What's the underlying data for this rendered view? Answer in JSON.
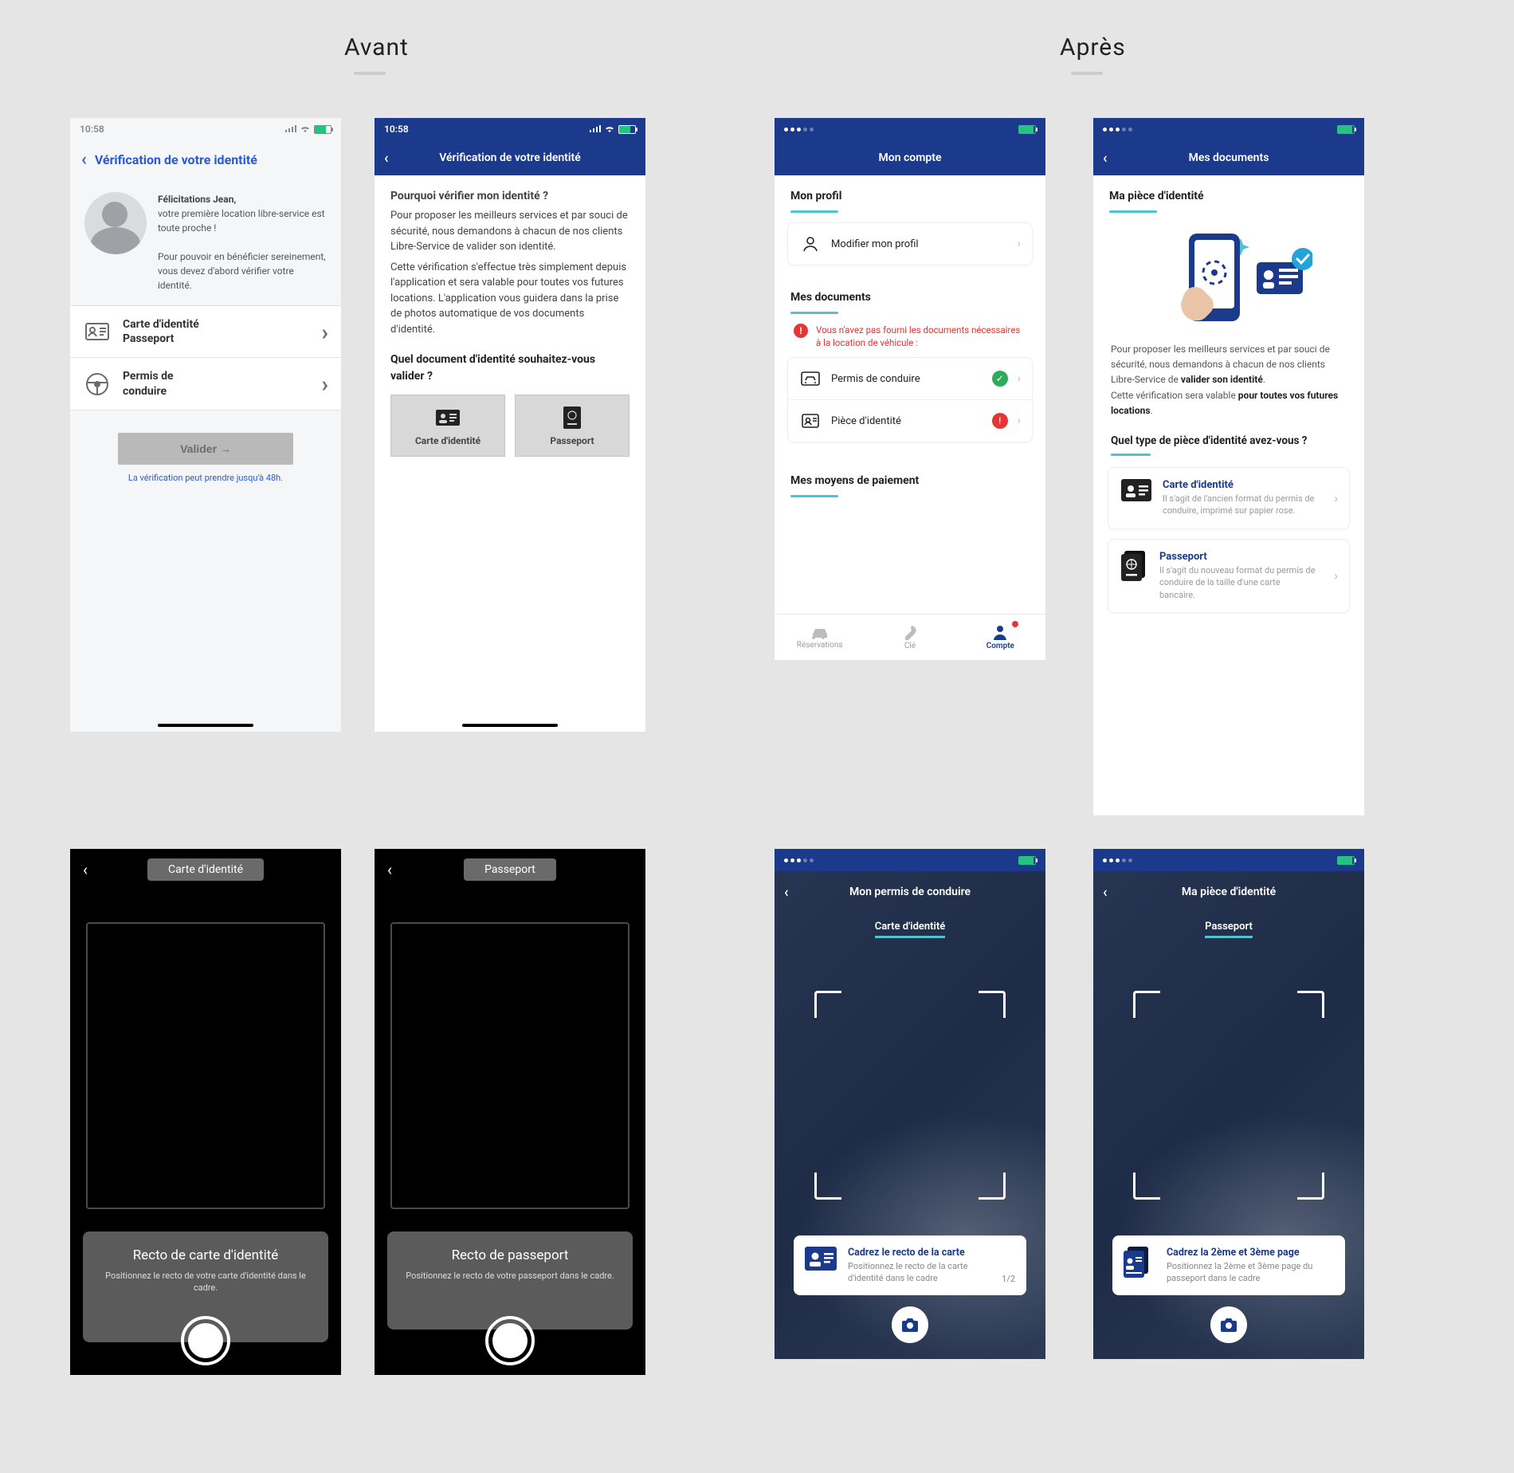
{
  "labels": {
    "before": "Avant",
    "after": "Après"
  },
  "a1": {
    "time": "10:58",
    "title": "Vérification de votre identité",
    "greeting_bold": "Félicitations Jean,",
    "greeting": "votre première location libre-service est toute proche !",
    "info": "Pour pouvoir en bénéficier sereinement, vous devez d'abord vérifier votre identité.",
    "rows": {
      "id": "Carte d'identité\nPasseport",
      "permit": "Permis de\nconduire"
    },
    "button": "Valider  →",
    "hint": "La vérification peut prendre jusqu'à 48h."
  },
  "a2": {
    "time": "10:58",
    "title": "Vérification de votre identité",
    "q1": "Pourquoi vérifier mon identité ?",
    "p1": "Pour proposer les meilleurs services et par souci de sécurité, nous demandons à chacun de nos clients Libre-Service de valider son identité.",
    "p2": "Cette vérification s'effectue très simplement depuis l'application et sera valable pour toutes vos futures locations. L'application vous guidera dans la prise de photos automatique de vos documents d'identité.",
    "q2": "Quel document d'identité souhaitez-vous valider ?",
    "opt1": "Carte d'identité",
    "opt2": "Passeport"
  },
  "b1": {
    "title": "Mon compte",
    "s1": "Mon profil",
    "row_profile": "Modifier mon profil",
    "s2": "Mes documents",
    "warn": "Vous n'avez pas fourni les documents nécessaires à la location de véhicule :",
    "row_permit": "Permis de conduire",
    "row_id": "Pièce d'identité",
    "s3": "Mes moyens de paiement",
    "tabs": {
      "res": "Réservations",
      "key": "Clé",
      "acc": "Compte"
    }
  },
  "b2": {
    "title": "Mes documents",
    "s1": "Ma pièce d'identité",
    "para1a": "Pour proposer les meilleurs services et par souci de sécurité, nous demandons à chacun de nos clients Libre-Service de ",
    "para1b": "valider son identité",
    "para1c": ".",
    "para2a": "Cette vérification sera valable ",
    "para2b": "pour toutes vos futures locations",
    "para2c": ".",
    "q": "Quel type de pièce d'identité avez-vous ?",
    "opt1_t": "Carte d'identité",
    "opt1_s": "Il s'agit de l'ancien format du permis de conduire, imprimé sur papier rose.",
    "opt2_t": "Passeport",
    "opt2_s": "Il s'agit du nouveau format du permis de conduire de la taille d'une carte bancaire."
  },
  "camOld1": {
    "chip": "Carte d'identité",
    "t": "Recto de carte d'identité",
    "s": "Positionnez le recto de votre carte d'identité dans le cadre."
  },
  "camOld2": {
    "chip": "Passeport",
    "t": "Recto de passeport",
    "s": "Positionnez le recto de votre passeport dans le cadre."
  },
  "camNew1": {
    "title": "Mon permis de conduire",
    "chip": "Carte d'identité",
    "t": "Cadrez le recto de la carte",
    "s": "Positionnez le recto de la carte d'identité dans le cadre",
    "pg": "1/2"
  },
  "camNew2": {
    "title": "Ma pièce d'identité",
    "chip": "Passeport",
    "t": "Cadrez la 2ème et 3ème page",
    "s": "Positionnez la 2ème et 3ème page du passeport dans le cadre"
  }
}
